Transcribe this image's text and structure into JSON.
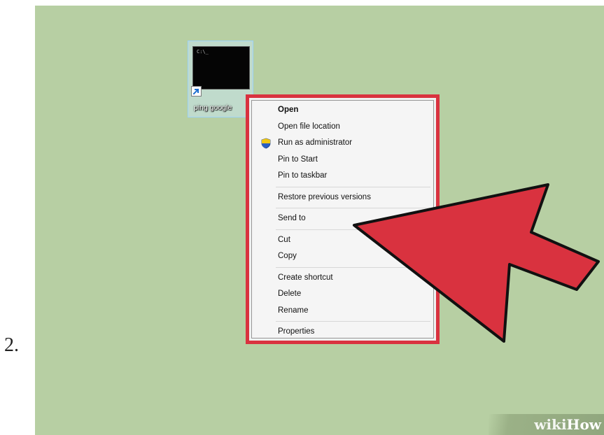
{
  "step": {
    "number": "2."
  },
  "desktop": {
    "background_color": "#b7cfa3",
    "shortcut": {
      "label": "ping google",
      "console_prompt": "C:\\_",
      "icon": "command-prompt-shortcut-icon",
      "overlay_icon": "shortcut-arrow-icon"
    }
  },
  "context_menu": {
    "highlight_color": "#d9323f",
    "groups": [
      [
        {
          "label": "Open",
          "bold": true
        },
        {
          "label": "Open file location"
        },
        {
          "label": "Run as administrator",
          "icon": "uac-shield-icon"
        },
        {
          "label": "Pin to Start"
        },
        {
          "label": "Pin to taskbar"
        }
      ],
      [
        {
          "label": "Restore previous versions"
        }
      ],
      [
        {
          "label": "Send to"
        }
      ],
      [
        {
          "label": "Cut"
        },
        {
          "label": "Copy"
        }
      ],
      [
        {
          "label": "Create shortcut"
        },
        {
          "label": "Delete"
        },
        {
          "label": "Rename"
        }
      ],
      [
        {
          "label": "Properties"
        }
      ]
    ]
  },
  "annotation": {
    "arrow_color": "#d9323f",
    "arrow_icon": "pointer-arrow-annotation"
  },
  "watermark": {
    "part1": "wiki",
    "part2": "How"
  }
}
